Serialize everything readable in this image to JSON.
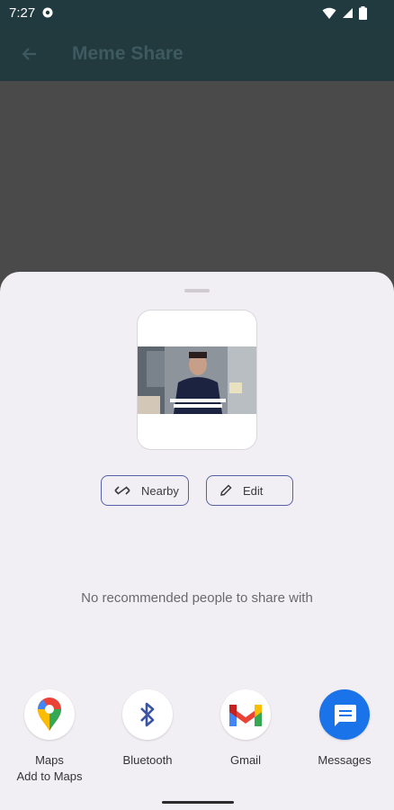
{
  "status_bar": {
    "time": "7:27"
  },
  "app_bar": {
    "title": "Meme Share"
  },
  "share_sheet": {
    "actions": [
      {
        "label": "Nearby",
        "icon": "nearby-share-icon"
      },
      {
        "label": "Edit",
        "icon": "pencil-icon"
      }
    ],
    "empty_people_text": "No recommended people to share with",
    "apps": [
      {
        "label": "Maps",
        "sublabel": "Add to Maps",
        "icon": "google-maps-icon"
      },
      {
        "label": "Bluetooth",
        "icon": "bluetooth-icon"
      },
      {
        "label": "Gmail",
        "icon": "gmail-icon"
      },
      {
        "label": "Messages",
        "icon": "messages-icon"
      }
    ]
  },
  "colors": {
    "app_bar": "#22393e",
    "sheet": "#f2eff4",
    "chip_border": "#5560a8",
    "messages_blue": "#1a73e8"
  }
}
